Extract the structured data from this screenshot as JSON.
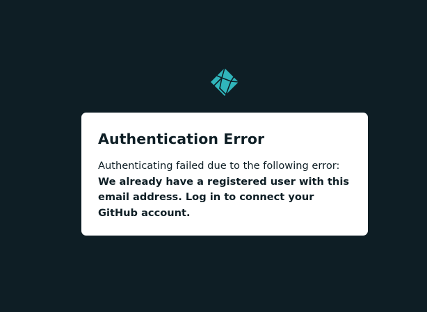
{
  "logo": {
    "icon": "netlify-logo-icon",
    "color": "#30b5bb"
  },
  "dialog": {
    "title": "Authentication Error",
    "intro": "Authenticating failed due to the following error:",
    "message": "We already have a registered user with this email address. Log in to connect your GitHub account."
  },
  "colors": {
    "background": "#0e1e25",
    "card": "#ffffff",
    "text": "#0e1e25"
  }
}
